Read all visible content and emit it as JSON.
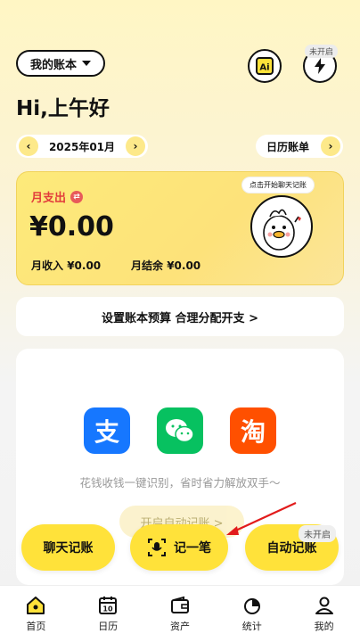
{
  "header": {
    "book_select": "我的账本",
    "not_open_tag": "未开启",
    "greeting": "Hi,上午好"
  },
  "month_nav": {
    "month": "2025年01月",
    "prev": "‹",
    "next": "›",
    "calendar_bill": "日历账单"
  },
  "summary": {
    "expense_label": "月支出",
    "expense_amount": "¥0.00",
    "income_label": "月收入",
    "income_amount": "¥0.00",
    "balance_label": "月结余",
    "balance_amount": "¥0.00",
    "bubble_text": "点击开始聊天记账"
  },
  "budget": {
    "text": "设置账本预算 合理分配开支 >"
  },
  "panel": {
    "apps": [
      {
        "glyph": "支",
        "color": "#1677ff"
      },
      {
        "glyph": "",
        "color": "#07c160"
      },
      {
        "glyph": "淘",
        "color": "#ff5000"
      }
    ],
    "tip": "花钱收钱一键识别，省时省力解放双手～",
    "auto_hint": "开启自动记账 >"
  },
  "actions": {
    "chat": "聊天记账",
    "record": "记一笔",
    "auto": "自动记账",
    "auto_tag": "未开启"
  },
  "tabs": [
    {
      "label": "首页",
      "icon": "home-icon"
    },
    {
      "label": "日历",
      "icon": "calendar-icon",
      "day": "10"
    },
    {
      "label": "资产",
      "icon": "wallet-icon"
    },
    {
      "label": "统计",
      "icon": "pie-chart-icon"
    },
    {
      "label": "我的",
      "icon": "user-icon"
    }
  ],
  "colors": {
    "accent": "#ffe23a",
    "expense_red": "#e23b3b"
  }
}
